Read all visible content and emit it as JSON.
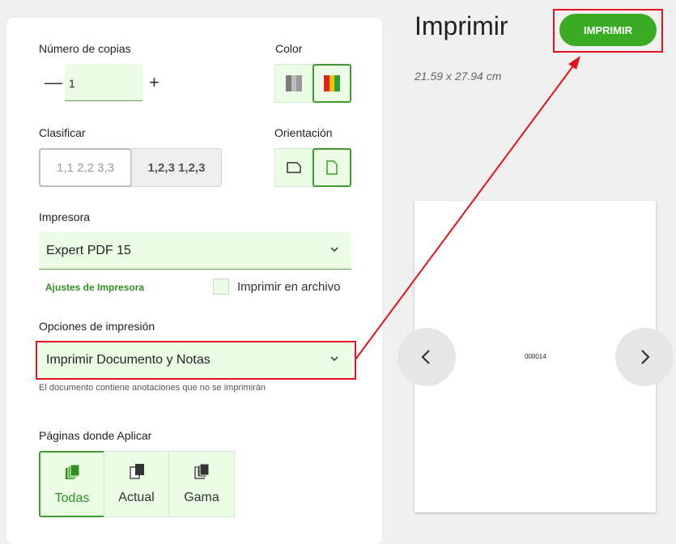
{
  "copies": {
    "label": "Número de copias",
    "value": "1",
    "minus": "—",
    "plus": "+"
  },
  "color": {
    "label": "Color",
    "options": [
      "grayscale-icon",
      "color-icon"
    ],
    "selected": 1
  },
  "collate": {
    "label": "Clasificar",
    "options": [
      "1,1 2,2 3,3",
      "1,2,3 1,2,3"
    ]
  },
  "orientation": {
    "label": "Orientación",
    "options": [
      "landscape-icon",
      "portrait-icon"
    ],
    "selected": 1
  },
  "printer": {
    "label": "Impresora",
    "selected": "Expert PDF 15",
    "settings_link": "Ajustes de Impresora",
    "print_to_file": "Imprimir en archivo"
  },
  "print_options": {
    "label": "Opciones de impresión",
    "selected": "Imprimir Documento y Notas",
    "hint": "El documento contiene anotaciones que no se imprimirán"
  },
  "pages": {
    "label": "Páginas donde Aplicar",
    "options": [
      "Todas",
      "Actual",
      "Gama"
    ],
    "selected": 0
  },
  "header": {
    "title": "Imprimir",
    "print_button": "IMPRIMIR"
  },
  "preview": {
    "dimensions": "21.59 x 27.94 cm",
    "page_number": "000014"
  },
  "colors": {
    "accent": "#3aac23",
    "field_bg": "#ecfde6",
    "highlight": "#e4121b"
  }
}
